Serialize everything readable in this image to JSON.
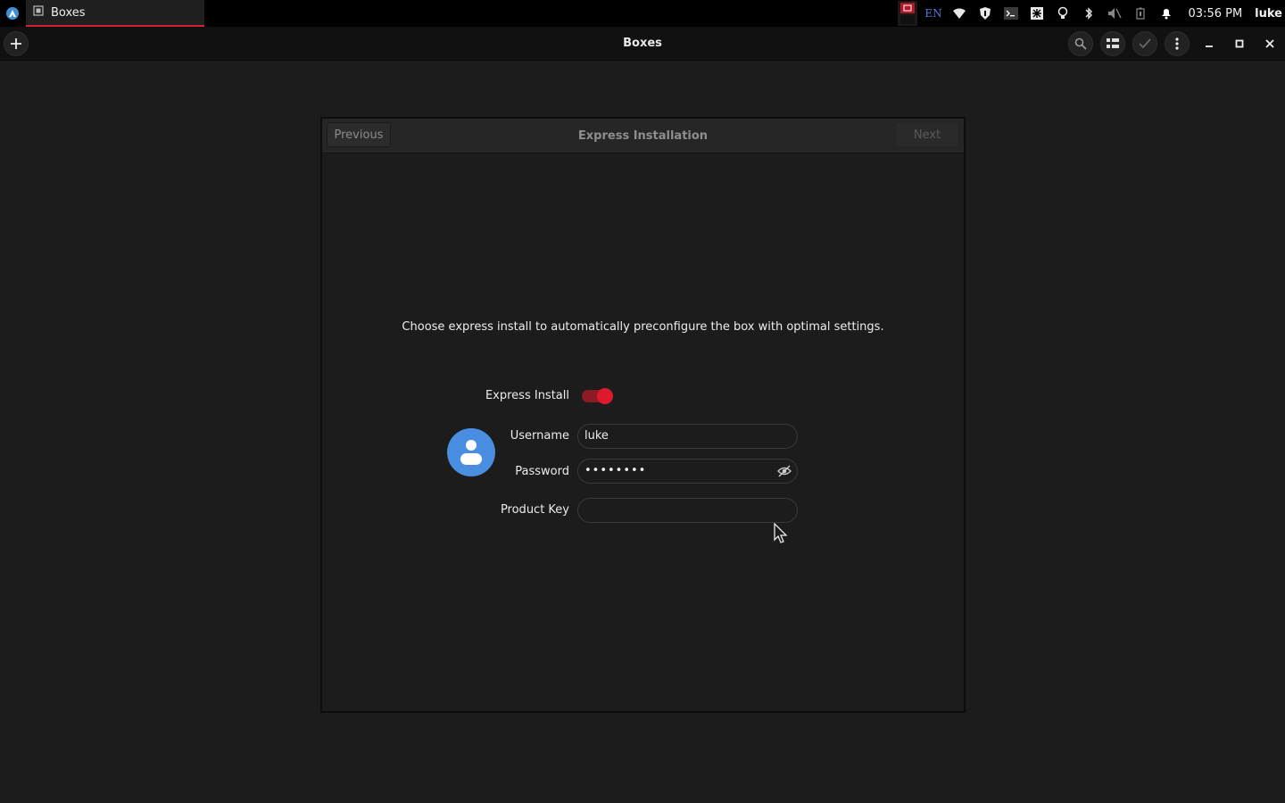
{
  "system_bar": {
    "task_title": "Boxes",
    "language": "EN",
    "clock": "03:56 PM",
    "user": "luke"
  },
  "headerbar": {
    "title": "Boxes"
  },
  "dialog": {
    "previous_label": "Previous",
    "title": "Express Installation",
    "next_label": "Next",
    "description": "Choose express install to automatically preconfigure the box with optimal settings.",
    "express_install_label": "Express Install",
    "express_install_enabled": true,
    "username_label": "Username",
    "username_value": "luke",
    "password_label": "Password",
    "password_value": "••••••••",
    "product_key_label": "Product Key",
    "product_key_value": ""
  },
  "colors": {
    "accent": "#e0182b",
    "avatar": "#4a8ee2",
    "language_text": "#5b74d6"
  }
}
